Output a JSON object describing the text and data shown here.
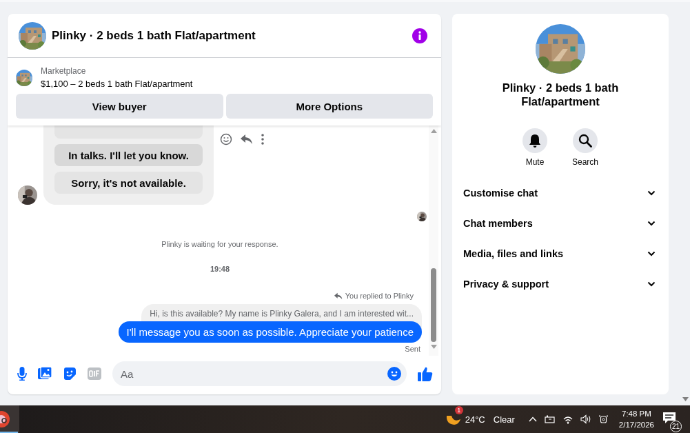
{
  "conversation": {
    "title": "Plinky · 2 beds 1 bath Flat/apartment"
  },
  "listing": {
    "source": "Marketplace",
    "summary": "$1,100 – 2 beds 1 bath Flat/apartment"
  },
  "actions": [
    "View buyer",
    "More Options"
  ],
  "quick_replies": [
    {
      "text": "In talks. I'll let you know.",
      "selected": true
    },
    {
      "text": "Sorry, it's not available.",
      "selected": false
    }
  ],
  "status_note": "Plinky is waiting for your response.",
  "timestamp": "19:48",
  "reply_label": "You replied to Plinky",
  "quoted_message": "Hi, is this available? My name is Plinky Galera, and I am interested wit...",
  "sent_message": "I'll message you as soon as possible. Appreciate your patience",
  "delivery_status": "Sent",
  "composer": {
    "placeholder": "Aa"
  },
  "details": {
    "title": "Plinky · 2 beds 1 bath Flat/apartment",
    "actions": [
      {
        "label": "Mute",
        "kind": "mute"
      },
      {
        "label": "Search",
        "kind": "search"
      }
    ],
    "sections": [
      {
        "label": "Customise chat",
        "expanded": false
      },
      {
        "label": "Chat members",
        "expanded": false
      },
      {
        "label": "Media, files and links",
        "expanded": false
      },
      {
        "label": "Privacy & support",
        "expanded": false
      }
    ]
  },
  "taskbar": {
    "weather_badge": "1",
    "temperature": "24°C",
    "condition": "Clear",
    "time": "7:48 PM",
    "date": "2/17/2026",
    "notification_count": "21"
  }
}
